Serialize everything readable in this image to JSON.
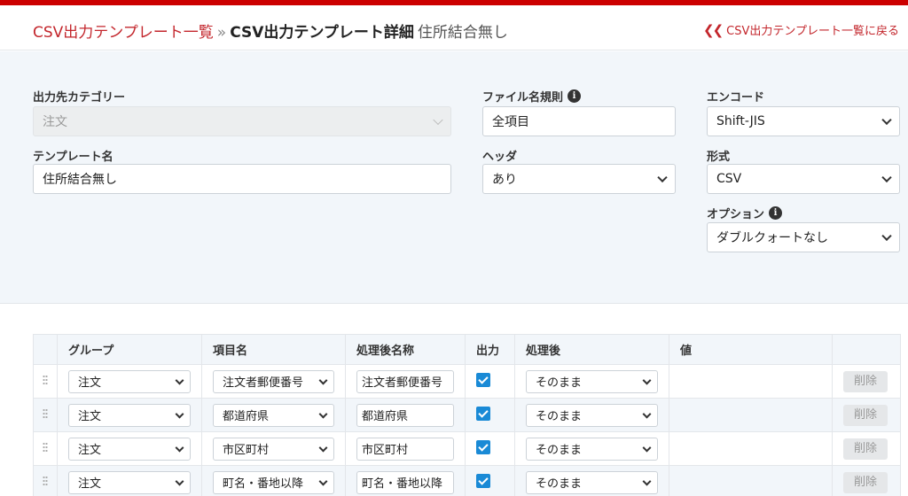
{
  "breadcrumb": {
    "list_link": "CSV出力テンプレート一覧",
    "separator": "»",
    "current": "CSV出力テンプレート詳細",
    "name": "住所結合無し"
  },
  "back_link": "CSV出力テンプレート一覧に戻る",
  "form": {
    "category": {
      "label": "出力先カテゴリー",
      "value": "注文"
    },
    "template_name": {
      "label": "テンプレート名",
      "value": "住所結合無し"
    },
    "filename_rule": {
      "label": "ファイル名規則",
      "value": "全項目"
    },
    "header": {
      "label": "ヘッダ",
      "value": "あり"
    },
    "encode": {
      "label": "エンコード",
      "value": "Shift-JIS"
    },
    "format": {
      "label": "形式",
      "value": "CSV"
    },
    "option": {
      "label": "オプション",
      "value": "ダブルクォートなし"
    }
  },
  "table": {
    "columns": [
      "グループ",
      "項目名",
      "処理後名称",
      "出力",
      "処理後",
      "値"
    ],
    "delete_label": "削除",
    "rows": [
      {
        "group": "注文",
        "item": "注文者郵便番号",
        "alias": "注文者郵便番号",
        "output": true,
        "process": "そのまま",
        "value": ""
      },
      {
        "group": "注文",
        "item": "都道府県",
        "alias": "都道府県",
        "output": true,
        "process": "そのまま",
        "value": ""
      },
      {
        "group": "注文",
        "item": "市区町村",
        "alias": "市区町村",
        "output": true,
        "process": "そのまま",
        "value": ""
      },
      {
        "group": "注文",
        "item": "町名・番地以降",
        "alias": "町名・番地以降",
        "output": true,
        "process": "そのまま",
        "value": ""
      }
    ]
  },
  "colors": {
    "brand_red": "#c3262c",
    "accent_blue": "#1a8ad6",
    "panel_bg": "#f2f6fa"
  }
}
